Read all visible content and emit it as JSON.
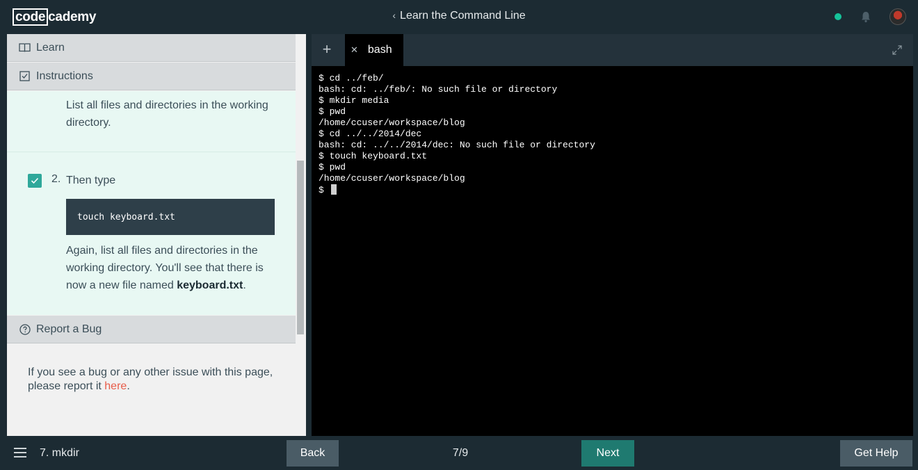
{
  "header": {
    "logo_code": "code",
    "logo_rest": "cademy",
    "course_title": "Learn the Command Line",
    "status_color": "#15c39a"
  },
  "sidebar": {
    "learn_label": "Learn",
    "instructions_label": "Instructions",
    "step1_text": "List all files and directories in the working directory.",
    "step2_number": "2.",
    "step2_text": "Then type",
    "step2_code": "touch keyboard.txt",
    "step2_more_prefix": "Again, list all files and directories in the working directory. You'll see that there is now a new file named ",
    "step2_more_bold": "keyboard.txt",
    "step2_more_suffix": ".",
    "bug_label": "Report a Bug",
    "bug_text": "If you see a bug or any other issue with this page, please report it ",
    "bug_link": "here",
    "bug_suffix": "."
  },
  "terminal": {
    "tab_label": "bash",
    "lines": [
      "$ cd ../feb/",
      "bash: cd: ../feb/: No such file or directory",
      "$ mkdir media",
      "$ pwd",
      "/home/ccuser/workspace/blog",
      "$ cd ../../2014/dec",
      "bash: cd: ../../2014/dec: No such file or directory",
      "$ touch keyboard.txt",
      "$ pwd",
      "/home/ccuser/workspace/blog"
    ],
    "prompt": "$ "
  },
  "footer": {
    "lesson_label": "7. mkdir",
    "back_label": "Back",
    "page_count": "7/9",
    "next_label": "Next",
    "help_label": "Get Help"
  },
  "icons": {
    "learn": "book-icon",
    "instructions": "checkbox-icon",
    "bug": "question-circle-icon",
    "bell": "bell-icon",
    "expand": "expand-icon",
    "menu": "menu-icon"
  }
}
